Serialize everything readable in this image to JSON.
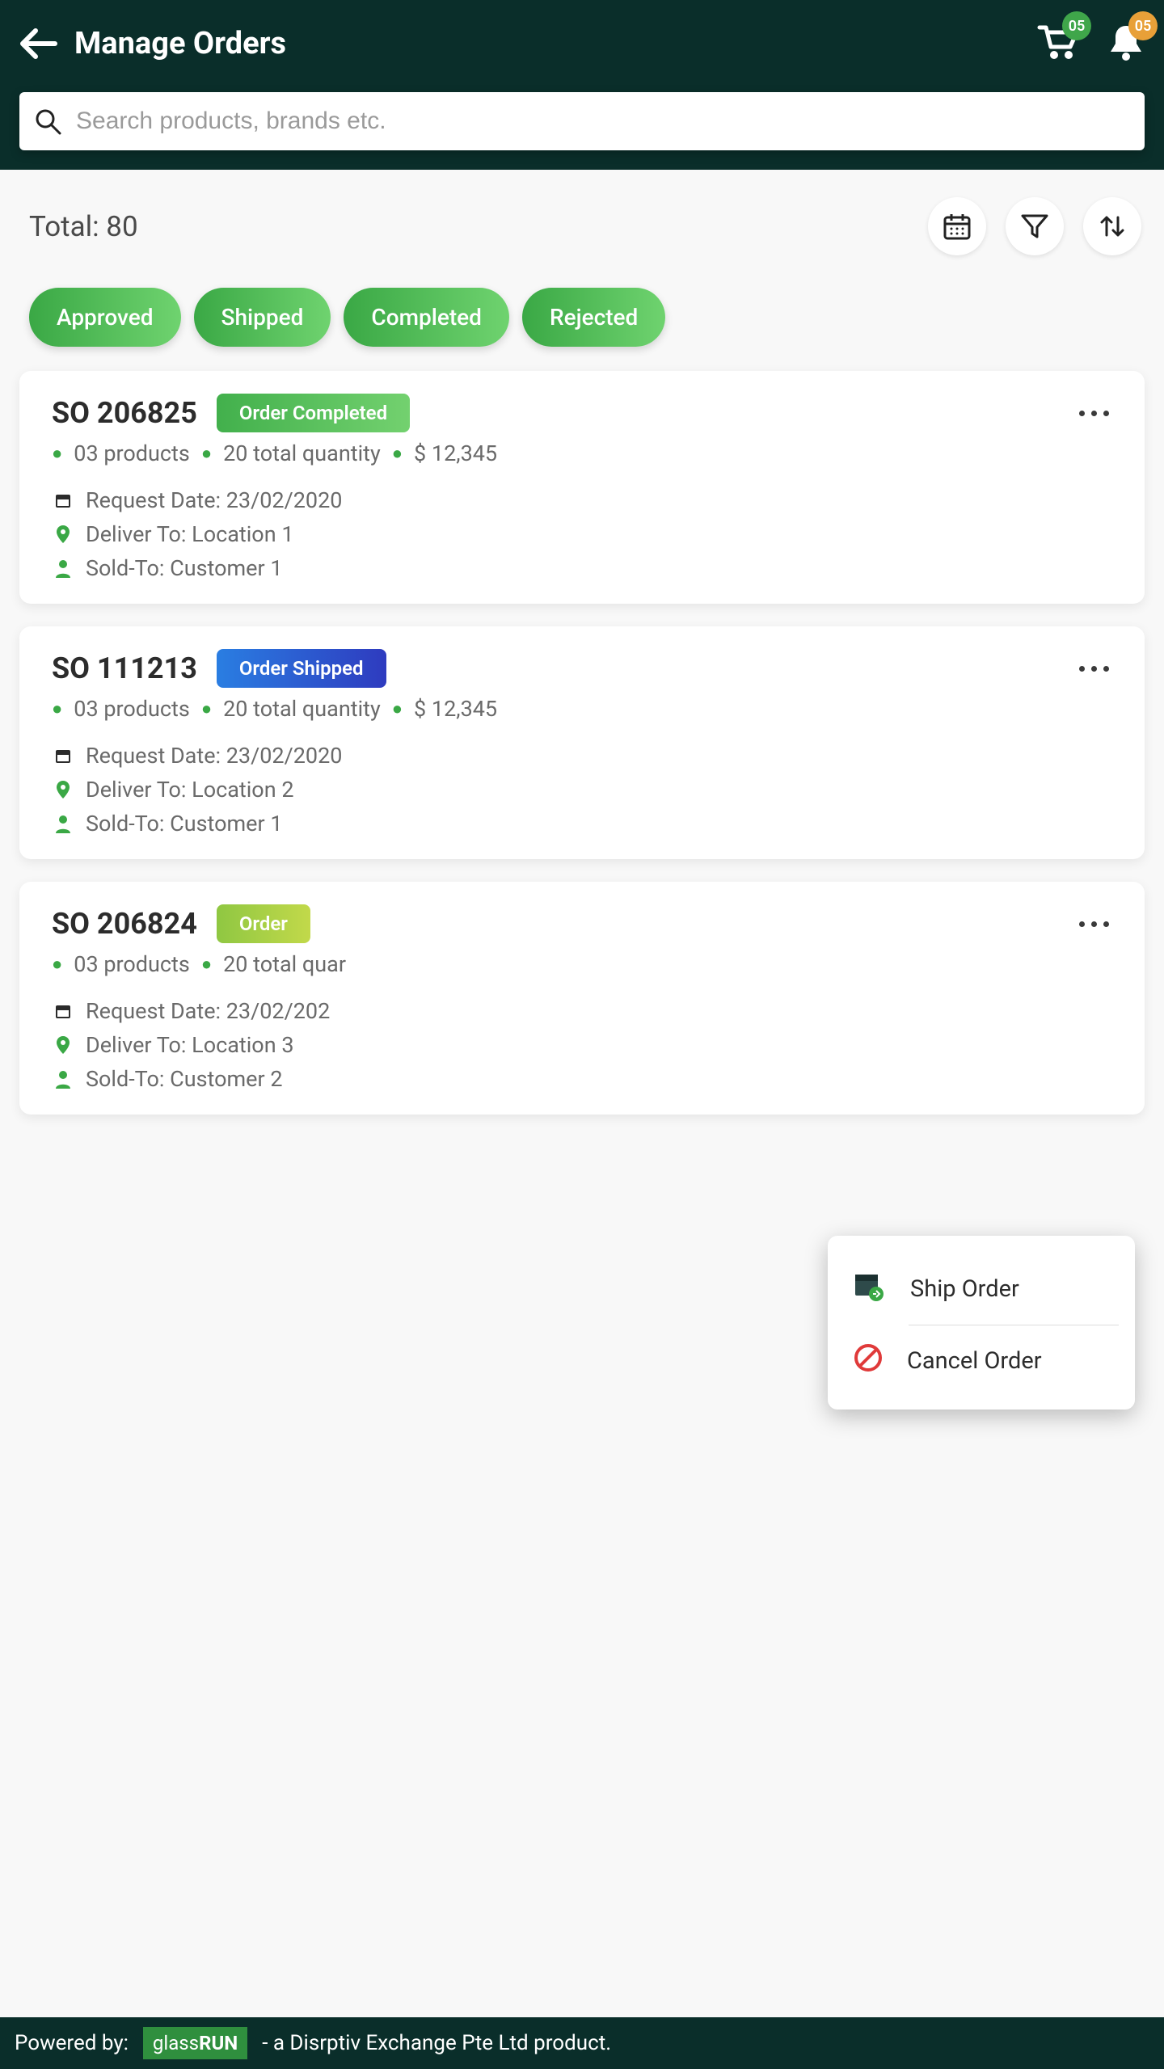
{
  "header": {
    "title": "Manage Orders",
    "cart_badge": "05",
    "bell_badge": "05"
  },
  "search": {
    "placeholder": "Search products, brands etc."
  },
  "summary": {
    "total_label": "Total: 80"
  },
  "filters": [
    "Approved",
    "Shipped",
    "Completed",
    "Rejected"
  ],
  "orders": [
    {
      "id": "SO 206825",
      "status": "Order Completed",
      "pill_class": "pill-green",
      "products": "03 products",
      "quantity": "20 total quantity",
      "amount": "$ 12,345",
      "request_date": "Request Date: 23/02/2020",
      "deliver_to": "Deliver To: Location 1",
      "sold_to": "Sold-To: Customer 1"
    },
    {
      "id": "SO 111213",
      "status": "Order Shipped",
      "pill_class": "pill-blue",
      "products": "03 products",
      "quantity": "20 total quantity",
      "amount": "$ 12,345",
      "request_date": "Request Date: 23/02/2020",
      "deliver_to": "Deliver To: Location 2",
      "sold_to": "Sold-To: Customer 1"
    },
    {
      "id": "SO 206824",
      "status": "Order",
      "pill_class": "pill-lime",
      "products": "03 products",
      "quantity": "20 total quar",
      "amount": "",
      "request_date": "Request Date: 23/02/202",
      "deliver_to": "Deliver To: Location 3",
      "sold_to": "Sold-To: Customer 2"
    }
  ],
  "popup": {
    "ship": "Ship Order",
    "cancel": "Cancel Order"
  },
  "footer": {
    "powered": "Powered by:",
    "logo1": "glass",
    "logo2": "RUN",
    "tag": "- a Disrptiv Exchange Pte Ltd product."
  }
}
